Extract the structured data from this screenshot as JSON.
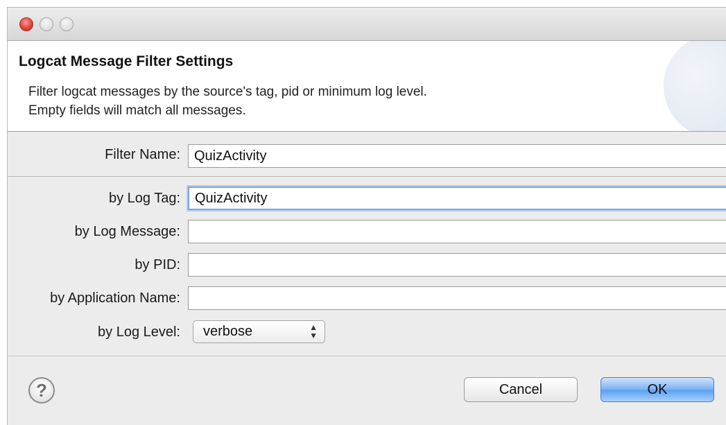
{
  "window": {
    "controls": [
      "close-icon",
      "minimize-icon",
      "zoom-icon"
    ],
    "control_colors": {
      "close": "#e0443e",
      "inactive": "#d4d4d4"
    }
  },
  "header": {
    "title": "Logcat Message Filter Settings",
    "description_line1": "Filter logcat messages by the source's tag, pid or minimum log level.",
    "description_line2": "Empty fields will match all messages."
  },
  "form": {
    "filter_name": {
      "label": "Filter Name:",
      "value": "QuizActivity"
    },
    "log_tag": {
      "label": "by Log Tag:",
      "value": "QuizActivity"
    },
    "log_message": {
      "label": "by Log Message:",
      "value": ""
    },
    "pid": {
      "label": "by PID:",
      "value": ""
    },
    "application_name": {
      "label": "by Application Name:",
      "value": ""
    },
    "log_level": {
      "label": "by Log Level:",
      "value": "verbose"
    }
  },
  "footer": {
    "help_icon": "question-mark-icon",
    "help_glyph": "?",
    "cancel_label": "Cancel",
    "ok_label": "OK",
    "accent_color": "#5b9ff0"
  }
}
